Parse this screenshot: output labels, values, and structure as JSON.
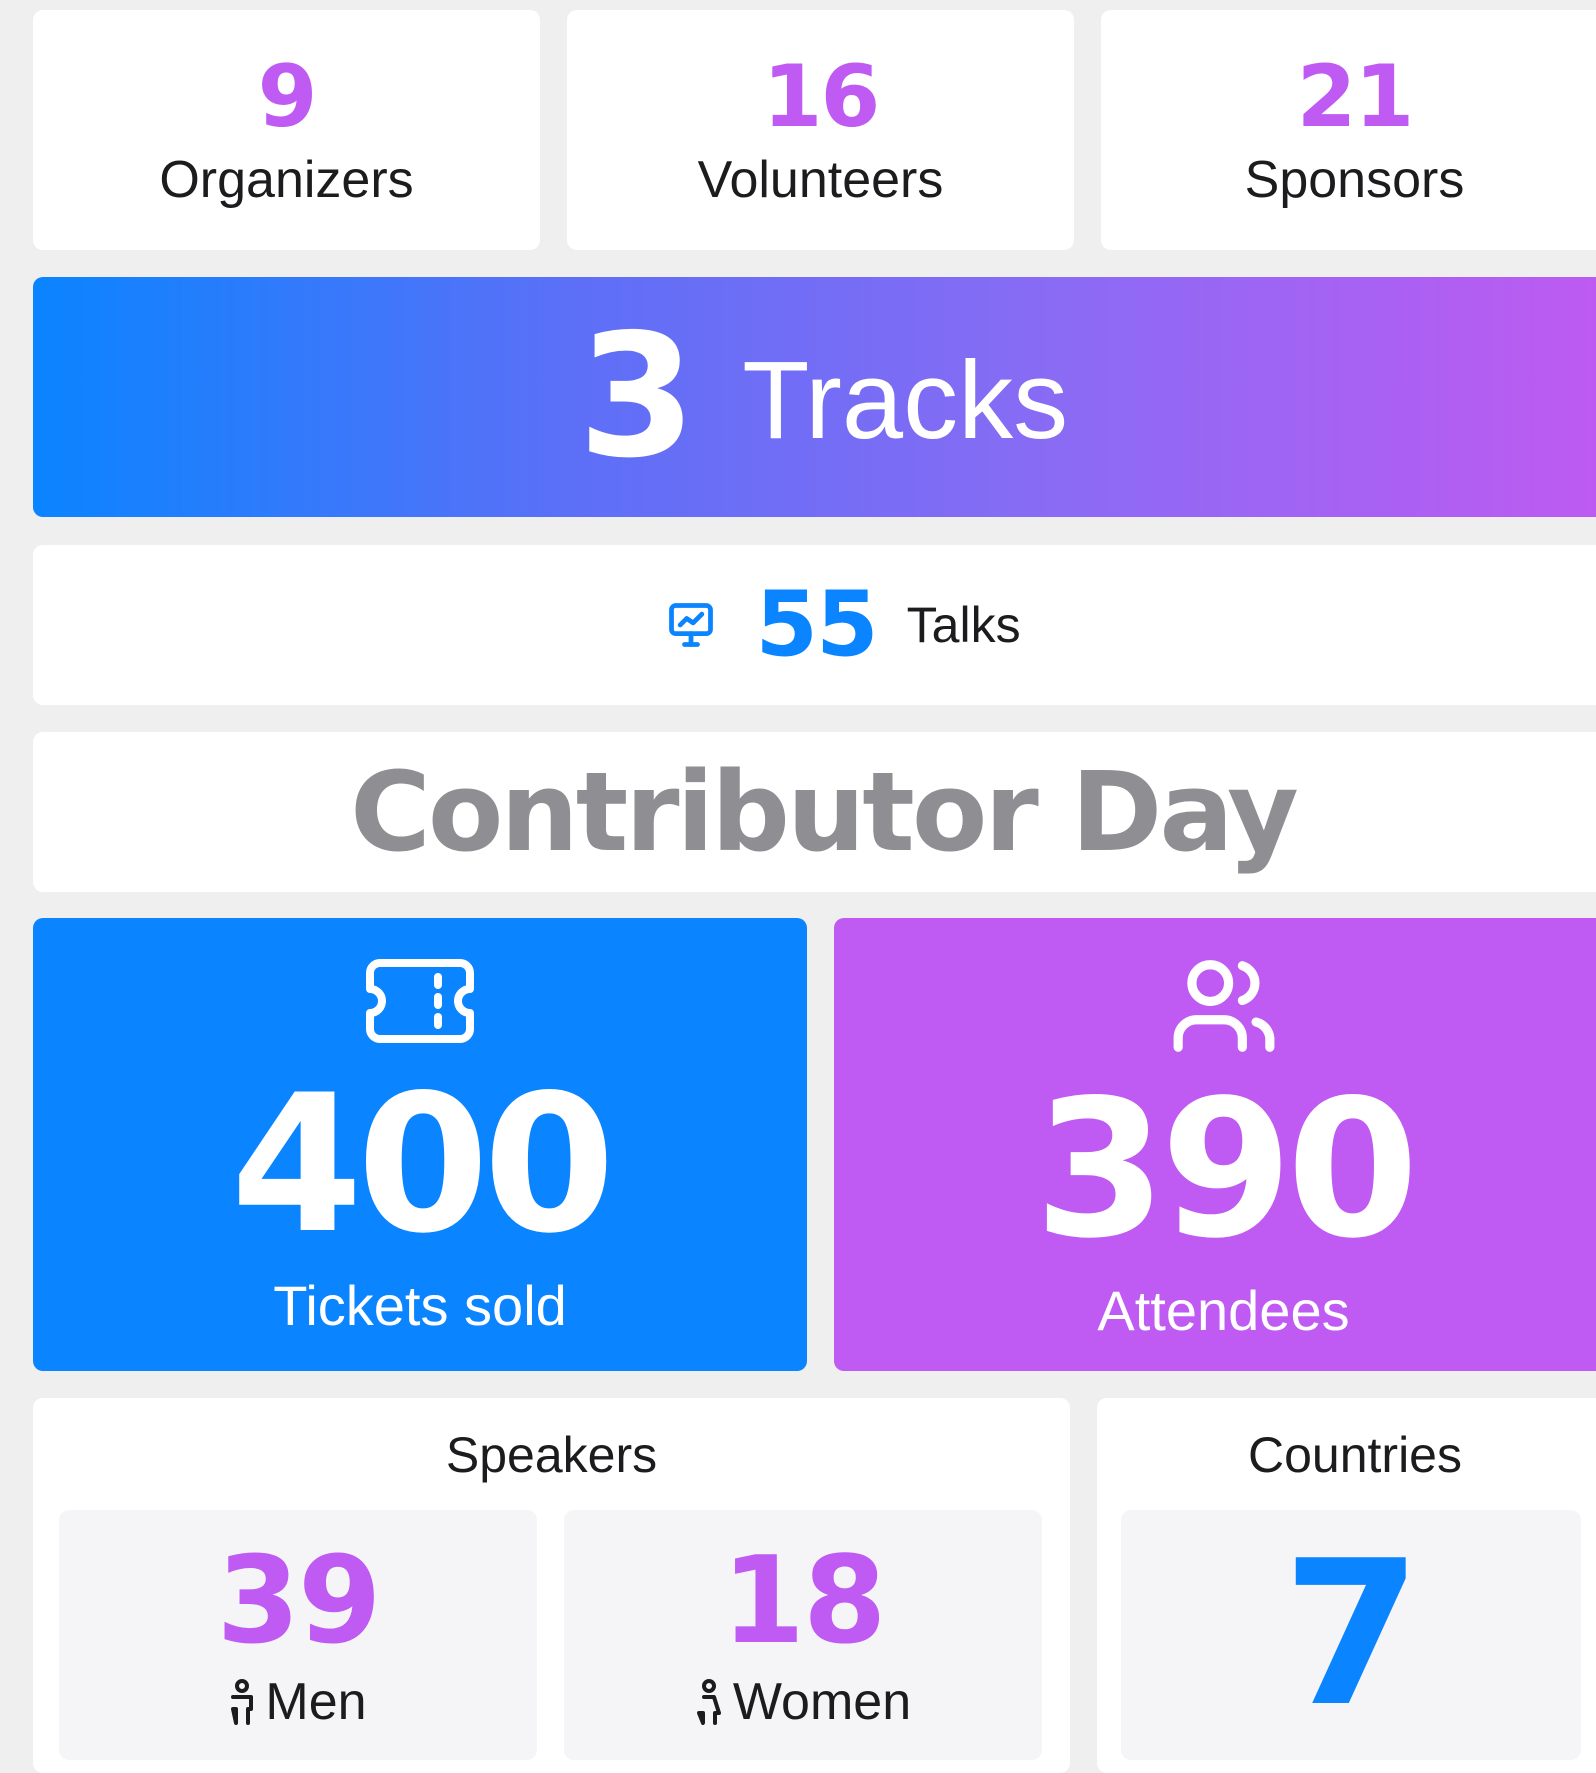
{
  "stats": [
    {
      "value": "9",
      "label": "Organizers"
    },
    {
      "value": "16",
      "label": "Volunteers"
    },
    {
      "value": "21",
      "label": "Sponsors"
    }
  ],
  "tracks": {
    "value": "3",
    "label": "Tracks"
  },
  "talks": {
    "icon": "presentation-chart-icon",
    "value": "55",
    "label": "Talks"
  },
  "contributor_day": {
    "title": "Contributor Day"
  },
  "tickets": {
    "icon": "ticket-icon",
    "value": "400",
    "label": "Tickets sold"
  },
  "attendees": {
    "icon": "users-icon",
    "value": "390",
    "label": "Attendees"
  },
  "speakers": {
    "title": "Speakers",
    "men": {
      "icon": "man-icon",
      "value": "39",
      "label": "Men"
    },
    "women": {
      "icon": "woman-icon",
      "value": "18",
      "label": "Women"
    }
  },
  "countries": {
    "title": "Countries",
    "value": "7"
  },
  "colors": {
    "background": "#efefef",
    "card": "#ffffff",
    "blue": "#0a84ff",
    "purple": "#bf5af2",
    "gray_title": "#8e8e93"
  }
}
